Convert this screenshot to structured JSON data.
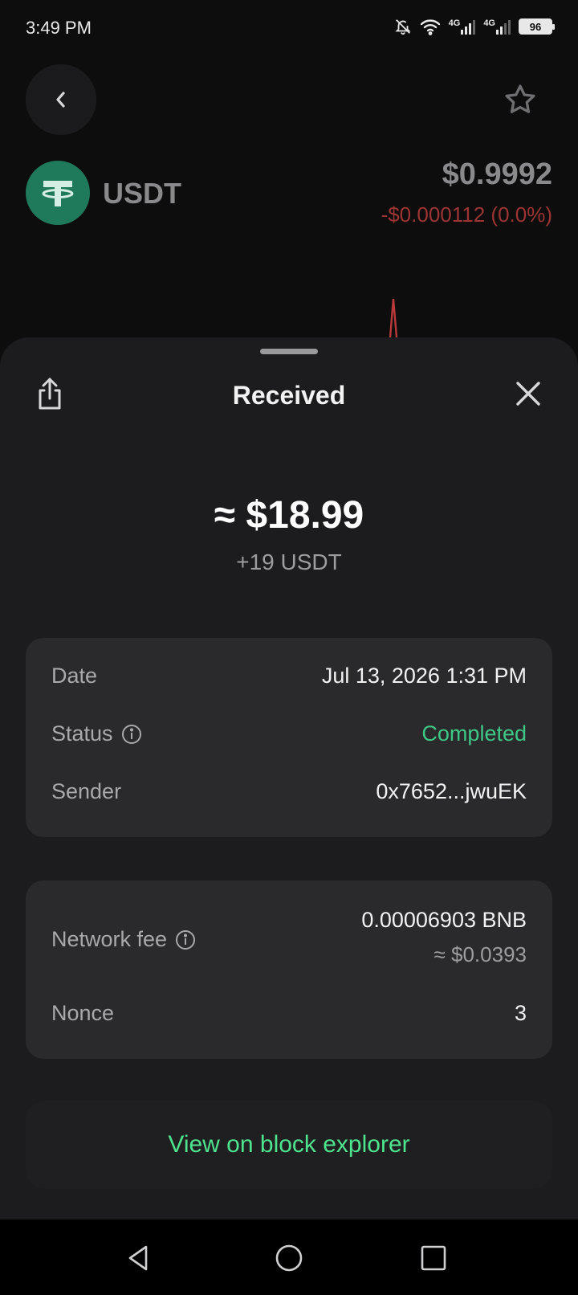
{
  "status_bar": {
    "time": "3:49 PM",
    "network_1": "4G",
    "network_2": "4G",
    "battery": "96"
  },
  "header": {
    "coin_name": "USDT",
    "price": "$0.9992",
    "change": "-$0.000112 (0.0%)"
  },
  "sheet": {
    "title": "Received",
    "amount_usd": "≈ $18.99",
    "amount_token": "+19 USDT",
    "details": {
      "date_label": "Date",
      "date_value": "Jul 13, 2026 1:31 PM",
      "status_label": "Status",
      "status_value": "Completed",
      "sender_label": "Sender",
      "sender_value": "0x7652...jwuEK"
    },
    "fees": {
      "network_fee_label": "Network fee",
      "network_fee_value": "0.00006903 BNB",
      "network_fee_usd": "≈ $0.0393",
      "nonce_label": "Nonce",
      "nonce_value": "3"
    },
    "explorer_link": "View on block explorer"
  },
  "colors": {
    "accent_green": "#4ee38d",
    "status_green": "#3ec786",
    "negative_red": "#9c3434",
    "tether_green": "#1f7a5c"
  },
  "icons": {
    "back": "chevron-left-icon",
    "favorite": "star-icon",
    "share": "share-icon",
    "close": "close-icon",
    "info": "info-icon"
  }
}
